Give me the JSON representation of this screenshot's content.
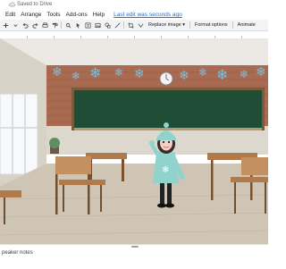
{
  "header": {
    "saved_status": "Saved to Drive"
  },
  "menu": {
    "items": [
      "Edit",
      "Arrange",
      "Tools",
      "Add-ons",
      "Help"
    ],
    "last_edit": "Last edit was seconds ago"
  },
  "toolbar": {
    "replace_image": "Replace image ▾",
    "format_options": "Format options",
    "animate": "Animate"
  },
  "notes": {
    "label": "peaker notes"
  },
  "colors": {
    "accent": "#1a73e8",
    "toolbar_bg": "#f1f3f4",
    "chalkboard": "#1f4d36",
    "avatar_teal": "#8fd3cc"
  }
}
